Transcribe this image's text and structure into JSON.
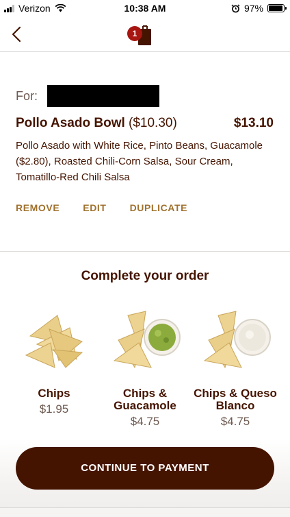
{
  "status_bar": {
    "carrier": "Verizon",
    "time": "10:38 AM",
    "battery": "97%",
    "battery_level": 0.97
  },
  "nav": {
    "bag_count": "1"
  },
  "order_item": {
    "for_label": "For:",
    "name": "Pollo Asado Bowl",
    "base_price": "($10.30)",
    "total": "$13.10",
    "description": "Pollo Asado with White Rice, Pinto Beans, Guacamole ($2.80), Roasted Chili-Corn Salsa, Sour Cream, Tomatillo-Red Chili Salsa",
    "actions": {
      "remove": "REMOVE",
      "edit": "EDIT",
      "duplicate": "DUPLICATE"
    }
  },
  "upsell": {
    "title": "Complete your order",
    "items": [
      {
        "name": "Chips",
        "price": "$1.95",
        "icon": "chips-icon"
      },
      {
        "name": "Chips & Guacamole",
        "price": "$4.75",
        "icon": "chips-guacamole-icon"
      },
      {
        "name": "Chips & Queso Blanco",
        "price": "$4.75",
        "icon": "chips-queso-icon"
      }
    ]
  },
  "footer": {
    "continue_label": "CONTINUE TO PAYMENT"
  },
  "colors": {
    "brand_brown": "#451400",
    "accent_gold": "#a0712d",
    "badge_red": "#a81612"
  }
}
